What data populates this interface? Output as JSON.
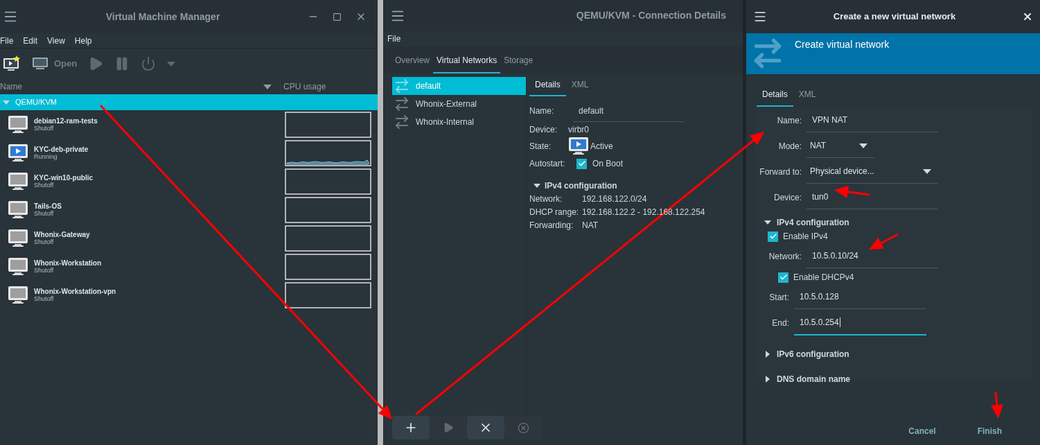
{
  "vm_manager": {
    "title": "Virtual Machine Manager",
    "menu": [
      "File",
      "Edit",
      "View",
      "Help"
    ],
    "toolbar": {
      "open_label": "Open"
    },
    "columns": [
      "Name",
      "CPU usage"
    ],
    "connection": {
      "name": "QEMU/KVM",
      "expanded": true,
      "selected": true
    },
    "vms": [
      {
        "name": "debian12-ram-tests",
        "status": "Shutoff",
        "running": false
      },
      {
        "name": "KYC-deb-private",
        "status": "Running",
        "running": true
      },
      {
        "name": "KYC-win10-public",
        "status": "Shutoff",
        "running": false
      },
      {
        "name": "Tails-OS",
        "status": "Shutoff",
        "running": false
      },
      {
        "name": "Whonix-Gateway",
        "status": "Shutoff",
        "running": false
      },
      {
        "name": "Whonix-Workstation",
        "status": "Shutoff",
        "running": false
      },
      {
        "name": "Whonix-Workstation-vpn",
        "status": "Shutoff",
        "running": false
      }
    ]
  },
  "connection_details": {
    "title": "QEMU/KVM - Connection Details",
    "menu": [
      "File"
    ],
    "tabs": [
      {
        "label": "Overview",
        "selected": false
      },
      {
        "label": "Virtual Networks",
        "selected": true
      },
      {
        "label": "Storage",
        "selected": false
      }
    ],
    "networks": [
      {
        "name": "default",
        "selected": true
      },
      {
        "name": "Whonix-External",
        "selected": false
      },
      {
        "name": "Whonix-Internal",
        "selected": false
      }
    ],
    "detail_tabs": [
      {
        "label": "Details",
        "selected": true
      },
      {
        "label": "XML",
        "selected": false
      }
    ],
    "name": {
      "label": "Name:",
      "value": "default"
    },
    "device": {
      "label": "Device:",
      "value": "virbr0"
    },
    "state": {
      "label": "State:",
      "value": "Active"
    },
    "autostart": {
      "label": "Autostart:",
      "option": "On Boot",
      "checked": true
    },
    "ipv4": {
      "title": "IPv4 configuration",
      "expanded": true,
      "rows": [
        {
          "label": "Network:",
          "value": "192.168.122.0/24"
        },
        {
          "label": "DHCP range:",
          "value": "192.168.122.2 - 192.168.122.254"
        },
        {
          "label": "Forwarding:",
          "value": "NAT"
        }
      ]
    },
    "actions": [
      {
        "kind": "add",
        "disabled": false
      },
      {
        "kind": "start",
        "disabled": true
      },
      {
        "kind": "stop",
        "disabled": false
      },
      {
        "kind": "delete",
        "disabled": true
      }
    ]
  },
  "create_network": {
    "title": "Create a new virtual network",
    "banner_title": "Create virtual network",
    "tabs": [
      {
        "label": "Details",
        "selected": true
      },
      {
        "label": "XML",
        "selected": false
      }
    ],
    "name": {
      "label": "Name:",
      "value": "VPN NAT"
    },
    "mode": {
      "label": "Mode:",
      "value": "NAT"
    },
    "forward_to": {
      "label": "Forward to:",
      "value": "Physical device..."
    },
    "device": {
      "label": "Device:",
      "value": "tun0"
    },
    "ipv4": {
      "title": "IPv4 configuration",
      "expanded": true,
      "enable_ipv4": {
        "label": "Enable IPv4",
        "checked": true
      },
      "network": {
        "label": "Network:",
        "value": "10.5.0.10/24"
      },
      "enable_dhcp": {
        "label": "Enable DHCPv4",
        "checked": true
      },
      "start": {
        "label": "Start:",
        "value": "10.5.0.128",
        "focused": false
      },
      "end": {
        "label": "End:",
        "value": "10.5.0.254",
        "focused": true
      }
    },
    "sections": [
      {
        "title": "IPv6 configuration",
        "expanded": false
      },
      {
        "title": "DNS domain name",
        "expanded": false
      }
    ],
    "buttons": [
      "Cancel",
      "Finish"
    ]
  }
}
